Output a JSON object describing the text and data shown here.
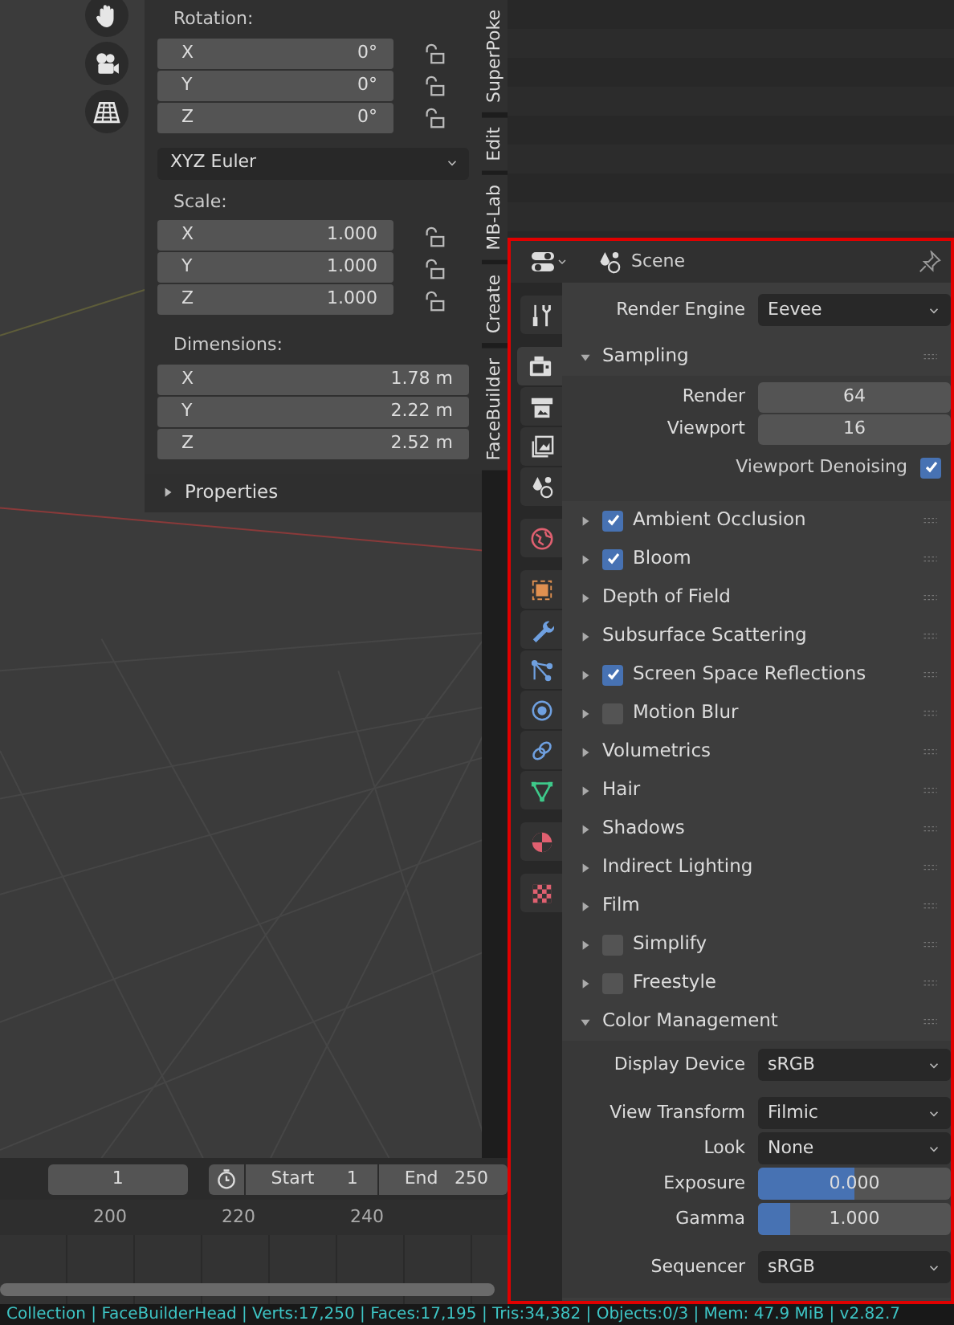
{
  "viewport_tools": [
    {
      "kind": "hand"
    },
    {
      "kind": "camera"
    },
    {
      "kind": "grid"
    }
  ],
  "sidebar_panel": {
    "groups": [
      {
        "label": "Rotation:",
        "kind": "locked",
        "fields": [
          {
            "axis": "X",
            "value": "0°"
          },
          {
            "axis": "Y",
            "value": "0°"
          },
          {
            "axis": "Z",
            "value": "0°"
          }
        ]
      },
      {
        "kind": "dropdown",
        "value": "XYZ Euler"
      },
      {
        "label": "Scale:",
        "kind": "locked",
        "fields": [
          {
            "axis": "X",
            "value": "1.000"
          },
          {
            "axis": "Y",
            "value": "1.000"
          },
          {
            "axis": "Z",
            "value": "1.000"
          }
        ]
      },
      {
        "label": "Dimensions:",
        "kind": "wide",
        "fields": [
          {
            "axis": "X",
            "value": "1.78 m"
          },
          {
            "axis": "Y",
            "value": "2.22 m"
          },
          {
            "axis": "Z",
            "value": "2.52 m"
          }
        ]
      }
    ],
    "collapsed_panel": {
      "title": "Properties",
      "expanded": false
    }
  },
  "sidebar_tabs": [
    {
      "label": "SuperPoke"
    },
    {
      "label": "Edit"
    },
    {
      "label": "MB-Lab"
    },
    {
      "label": "Create"
    },
    {
      "label": "FaceBuilder"
    }
  ],
  "timeline": {
    "current_frame": "1",
    "start_label": "Start",
    "start": "1",
    "end_label": "End",
    "end": "250",
    "ruler": [
      "200",
      "220",
      "240"
    ]
  },
  "properties": {
    "context": "Scene",
    "tabs": [
      {
        "kind": "tool",
        "selected": false
      },
      {
        "kind": "render",
        "selected": true
      },
      {
        "kind": "output",
        "selected": false
      },
      {
        "kind": "view_layer",
        "selected": false
      },
      {
        "kind": "scene",
        "selected": false
      },
      {
        "kind": "world",
        "selected": false
      },
      {
        "kind": "object",
        "selected": false
      },
      {
        "kind": "modifier",
        "selected": false
      },
      {
        "kind": "particles",
        "selected": false
      },
      {
        "kind": "physics",
        "selected": false
      },
      {
        "kind": "constraints",
        "selected": false
      },
      {
        "kind": "data",
        "selected": false
      },
      {
        "kind": "material",
        "selected": false
      },
      {
        "kind": "texture",
        "selected": false
      }
    ],
    "render_engine": {
      "label": "Render Engine",
      "value": "Eevee"
    },
    "sections": [
      {
        "title": "Sampling",
        "kind": "plain",
        "expanded": true,
        "fields": [
          {
            "kind": "number",
            "label": "Render",
            "value": "64"
          },
          {
            "kind": "number",
            "label": "Viewport",
            "value": "16"
          },
          {
            "kind": "toggle",
            "label": "Viewport Denoising",
            "checked": true
          }
        ]
      },
      {
        "title": "Ambient Occlusion",
        "kind": "check",
        "checked": true,
        "expanded": false
      },
      {
        "title": "Bloom",
        "kind": "check",
        "checked": true,
        "expanded": false
      },
      {
        "title": "Depth of Field",
        "kind": "plain",
        "expanded": false
      },
      {
        "title": "Subsurface Scattering",
        "kind": "plain",
        "expanded": false
      },
      {
        "title": "Screen Space Reflections",
        "kind": "check",
        "checked": true,
        "expanded": false
      },
      {
        "title": "Motion Blur",
        "kind": "check",
        "checked": false,
        "expanded": false
      },
      {
        "title": "Volumetrics",
        "kind": "plain",
        "expanded": false
      },
      {
        "title": "Hair",
        "kind": "plain",
        "expanded": false
      },
      {
        "title": "Shadows",
        "kind": "plain",
        "expanded": false
      },
      {
        "title": "Indirect Lighting",
        "kind": "plain",
        "expanded": false
      },
      {
        "title": "Film",
        "kind": "plain",
        "expanded": false
      },
      {
        "title": "Simplify",
        "kind": "check",
        "checked": false,
        "expanded": false
      },
      {
        "title": "Freestyle",
        "kind": "check",
        "checked": false,
        "expanded": false
      },
      {
        "title": "Color Management",
        "kind": "plain",
        "expanded": true,
        "fields": [
          {
            "kind": "dropdown",
            "label": "Display Device",
            "value": "sRGB"
          },
          {
            "kind": "dropdown",
            "label": "View Transform",
            "value": "Filmic"
          },
          {
            "kind": "dropdown",
            "label": "Look",
            "value": "None"
          },
          {
            "kind": "slider",
            "label": "Exposure",
            "value": "0.000",
            "level": 0.5
          },
          {
            "kind": "slider",
            "label": "Gamma",
            "value": "1.000",
            "level": 0.17
          },
          {
            "kind": "dropdown",
            "label": "Sequencer",
            "value": "sRGB"
          }
        ]
      }
    ]
  },
  "status_bar": "Collection | FaceBuilderHead | Verts:17,250 | Faces:17,195 | Tris:34,382 | Objects:0/3 | Mem: 47.9 MiB | v2.82.7"
}
